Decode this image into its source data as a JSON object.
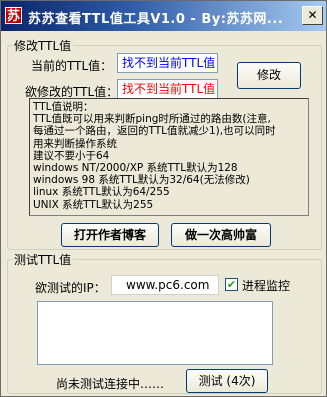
{
  "window": {
    "title": "苏苏查看TTL值工具V1.0  - By:苏苏网...",
    "icon_glyph": "苏",
    "close_glyph": "✕"
  },
  "modify_group": {
    "legend": "修改TTL值",
    "current_label": "当前的TTL值：",
    "current_value": "找不到当前TTL值",
    "desired_label": "欲修改的TTL值：",
    "desired_value": "找不到当前TTL值",
    "modify_button": "修改",
    "info_lines": [
      "TTL值说明：",
      "TTL值既可以用来判断ping时所通过的路由数(注意,",
      "每通过一个路由，返回的TTL值就减少1),也可以同时",
      "用来判断操作系统",
      "建议不要小于64",
      "windows NT/2000/XP 系统TTL默认为128",
      "windows 98 系统TTL默认为32/64(无法修改)",
      "linux 系统TTL默认为64/255",
      "UNIX 系统TTL默认为255"
    ]
  },
  "actions": {
    "open_blog": "打开作者博客",
    "dance": "做一次高帅富"
  },
  "test_group": {
    "legend": "测试TTL值",
    "ip_label": "欲测试的IP：",
    "ip_value": "www.pc6.com",
    "monitor_label": "进程监控",
    "monitor_checked": true,
    "status": "尚未测试连接中……",
    "test_button": "测试 (4次)"
  },
  "colors": {
    "current_value_color": "#0000ff",
    "desired_value_color": "#ff0000",
    "title_bar": "#0a246a"
  }
}
